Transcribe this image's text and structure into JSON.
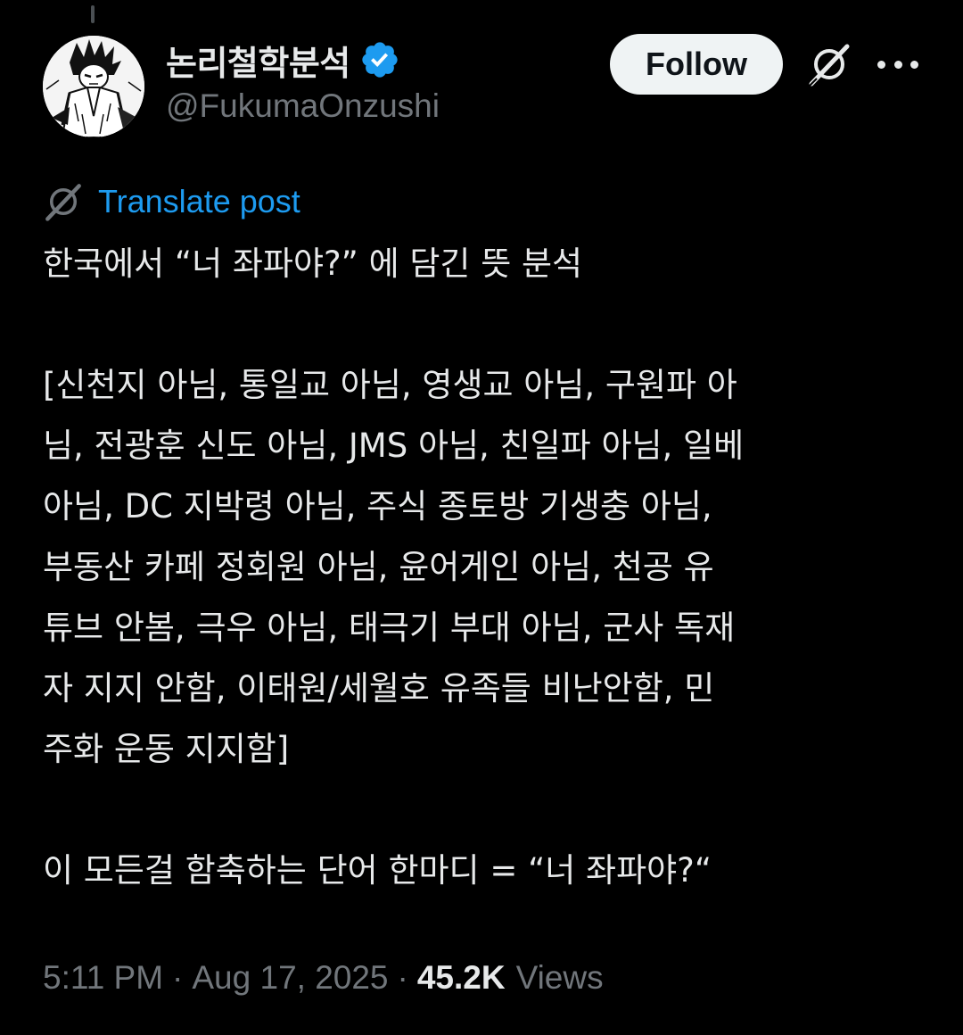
{
  "author": {
    "display_name": "논리철학분석",
    "handle": "@FukumaOnzushi",
    "avatar_icon": "manga-character-avatar",
    "verified_icon": "verified-badge-icon",
    "verified_color": "#1d9bf0"
  },
  "actions": {
    "follow_label": "Follow",
    "grok_icon": "grok-icon",
    "more_icon": "more-options-icon"
  },
  "translate": {
    "icon": "grok-icon",
    "label": "Translate post"
  },
  "post": {
    "lines": [
      "한국에서 “너 좌파야?” 에 담긴 뜻 분석",
      "",
      "[신천지 아님, 통일교 아님, 영생교 아님, 구원파 아",
      "님, 전광훈 신도 아님, JMS 아님, 친일파 아님, 일베",
      "아님, DC 지박령 아님, 주식 종토방 기생충 아님,",
      "부동산 카페 정회원 아님, 윤어게인 아님, 천공 유",
      "튜브 안봄, 극우 아님, 태극기 부대 아님, 군사 독재",
      "자 지지 안함, 이태원/세월호 유족들 비난안함, 민",
      "주화 운동 지지함]",
      "",
      "이 모든걸 함축하는 단어 한마디 = “너 좌파야?“"
    ]
  },
  "meta": {
    "time": "5:11 PM",
    "separator": "·",
    "date": "Aug 17, 2025",
    "views_count": "45.2K",
    "views_label": "Views"
  },
  "colors": {
    "background": "#000000",
    "text": "#e7e9ea",
    "secondary": "#71767b",
    "link": "#1d9bf0",
    "button_bg": "#eff3f4"
  }
}
